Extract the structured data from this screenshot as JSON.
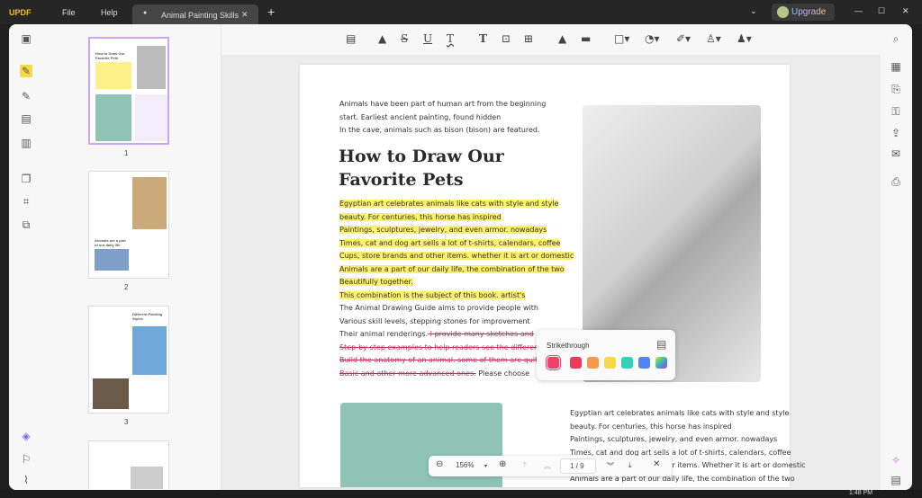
{
  "app": {
    "logo": "UPDF",
    "menu": [
      "File",
      "Help"
    ],
    "tab_title": "Animal Painting Skills",
    "upgrade": "Upgrade"
  },
  "thumbnails": [
    {
      "page": "1",
      "title": "How to Draw Our Favorite Pets"
    },
    {
      "page": "2",
      "title": "Animals are a part of our daily life"
    },
    {
      "page": "3",
      "title": "Different Painting Styles"
    }
  ],
  "document": {
    "intro": [
      "Animals have been part of human art from the beginning",
      "start. Earliest ancient painting, found hidden",
      "In the cave, animals such as bison (bison) are featured."
    ],
    "heading": [
      "How to Draw Our",
      "Favorite Pets"
    ],
    "highlighted": [
      "Egyptian art celebrates animals like cats with style and style",
      "beauty. For centuries, this horse has inspired",
      "Paintings, sculptures, jewelry, and even armor. nowadays",
      "Times, cat and dog art sells a lot of t-shirts, calendars, coffee",
      "Cups, store brands and other items. whether it is art or domestic",
      "Animals are a part of our daily life, the combination of the two",
      "Beautifully together.",
      "This combination is the subject of this book. artist's"
    ],
    "plain": [
      "The Animal Drawing Guide aims to provide people with",
      "Various skill levels, stepping stones for improvement"
    ],
    "mixed_start": "Their animal renderings.",
    "struck": [
      " I provide many sketches and",
      "Step-by-step examples to help readers see the different ways",
      "Build the anatomy of an animal. some of them are quite",
      "Basic and other more advanced ones."
    ],
    "after_strike": " Please choose",
    "col2": [
      "Egyptian art celebrates animals like cats with style and style",
      "beauty. For centuries, this horse has inspired",
      "Paintings, sculptures, jewelry, and even armor. nowadays",
      "Times, cat and dog art sells a lot of t-shirts, calendars, coffee",
      "Cups, store brands and other items. Whether it is art or domestic",
      "Animals are a part of our daily life, the combination of the two"
    ]
  },
  "popup": {
    "label": "Strikethrough",
    "colors": [
      "#f0406a",
      "#f03a5a",
      "#f59a4a",
      "#f7d84a",
      "#33d0b8",
      "#4f86f5",
      "rainbow"
    ]
  },
  "zoombar": {
    "zoom": "156%",
    "page": "1 / 9"
  },
  "taskbar": {
    "time": "1:48 PM"
  }
}
